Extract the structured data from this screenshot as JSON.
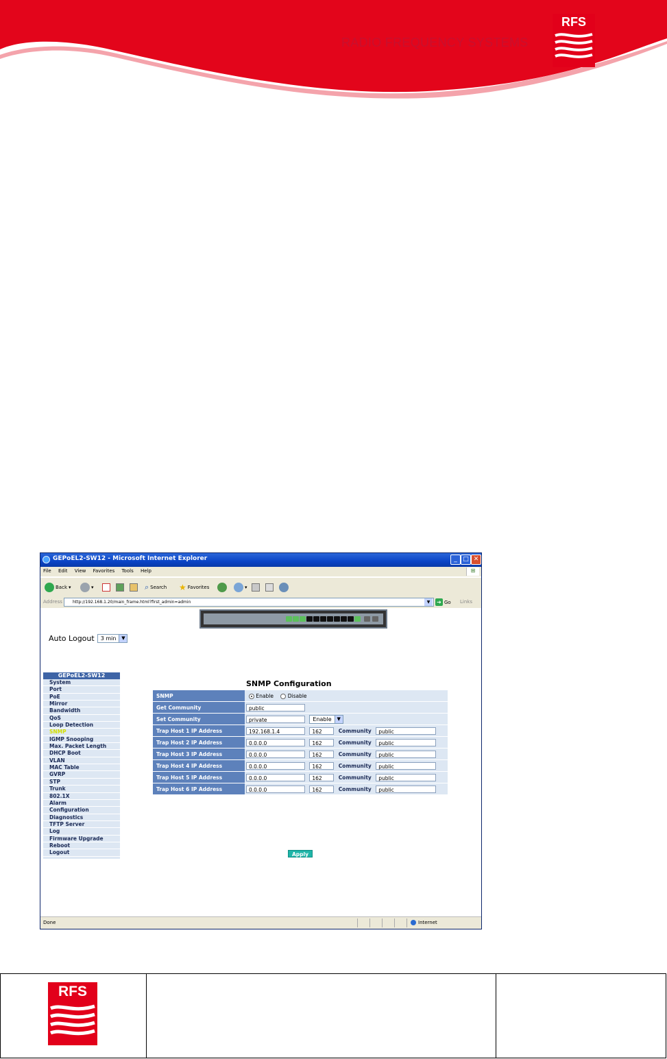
{
  "header": {
    "brand_text": "RADIO FREQUENCY SYSTEMS",
    "logo_text": "RFS",
    "brand_color": "#e2001a"
  },
  "window": {
    "title": "GEPoEL2-SW12 - Microsoft Internet Explorer",
    "menu": [
      "File",
      "Edit",
      "View",
      "Favorites",
      "Tools",
      "Help"
    ],
    "toolbar": {
      "back_label": "Back",
      "search_label": "Search",
      "favorites_label": "Favorites"
    },
    "address_label": "Address",
    "address_url": "http://192.168.1.20/main_frame.html?first_admin=admin",
    "go_label": "Go",
    "links_label": "Links",
    "status_text": "Done",
    "zone_text": "Internet"
  },
  "page": {
    "auto_logout_label": "Auto Logout",
    "auto_logout_value": "3 min",
    "nav_header": "GEPoEL2-SW12",
    "nav_items": [
      "System",
      "Port",
      "PoE",
      "Mirror",
      "Bandwidth",
      "QoS",
      "Loop Detection",
      "SNMP",
      "IGMP Snooping",
      "Max. Packet Length",
      "DHCP Boot",
      "VLAN",
      "MAC Table",
      "GVRP",
      "STP",
      "Trunk",
      "802.1X",
      "Alarm",
      "Configuration",
      "Diagnostics",
      "TFTP Server",
      "Log",
      "Firmware Upgrade",
      "Reboot",
      "Logout"
    ],
    "nav_active": "SNMP",
    "title": "SNMP Configuration",
    "snmp": {
      "label": "SNMP",
      "enable_label": "Enable",
      "disable_label": "Disable",
      "selected": "Enable"
    },
    "get_community": {
      "label": "Get Community",
      "value": "public"
    },
    "set_community": {
      "label": "Set Community",
      "value": "private",
      "select_value": "Enable"
    },
    "community_label": "Community",
    "trap_hosts": [
      {
        "label": "Trap Host 1 IP Address",
        "ip": "192.168.1.4",
        "port": "162",
        "community": "public"
      },
      {
        "label": "Trap Host 2 IP Address",
        "ip": "0.0.0.0",
        "port": "162",
        "community": "public"
      },
      {
        "label": "Trap Host 3 IP Address",
        "ip": "0.0.0.0",
        "port": "162",
        "community": "public"
      },
      {
        "label": "Trap Host 4 IP Address",
        "ip": "0.0.0.0",
        "port": "162",
        "community": "public"
      },
      {
        "label": "Trap Host 5 IP Address",
        "ip": "0.0.0.0",
        "port": "162",
        "community": "public"
      },
      {
        "label": "Trap Host 6 IP Address",
        "ip": "0.0.0.0",
        "port": "162",
        "community": "public"
      }
    ],
    "apply_label": "Apply"
  },
  "footer": {
    "logo_text": "RFS"
  }
}
